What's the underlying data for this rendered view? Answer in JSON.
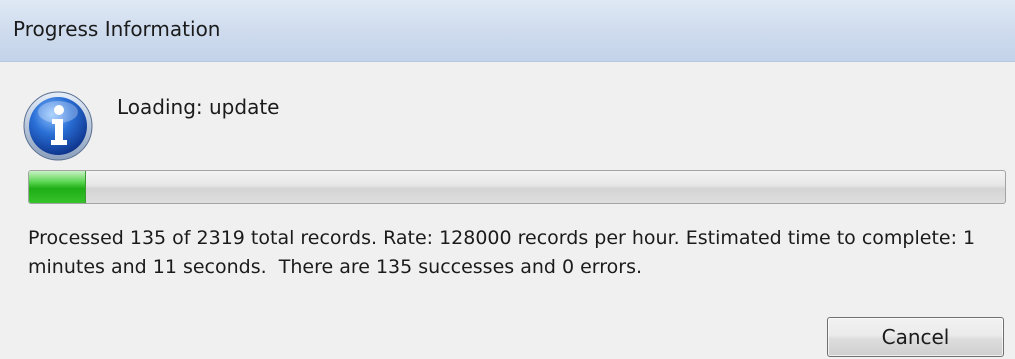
{
  "window": {
    "title": "Progress Information"
  },
  "message": {
    "icon": "info-icon",
    "text": "Loading: update"
  },
  "progress": {
    "processed": 135,
    "total": 2319,
    "fraction": 0.058,
    "fill_color": "#1fae16"
  },
  "status": {
    "text": "Processed 135 of 2319 total records. Rate: 128000 records per hour. Estimated time to complete: 1 minutes and 11 seconds.  There are 135 successes and 0 errors."
  },
  "buttons": {
    "cancel_label": "Cancel"
  }
}
